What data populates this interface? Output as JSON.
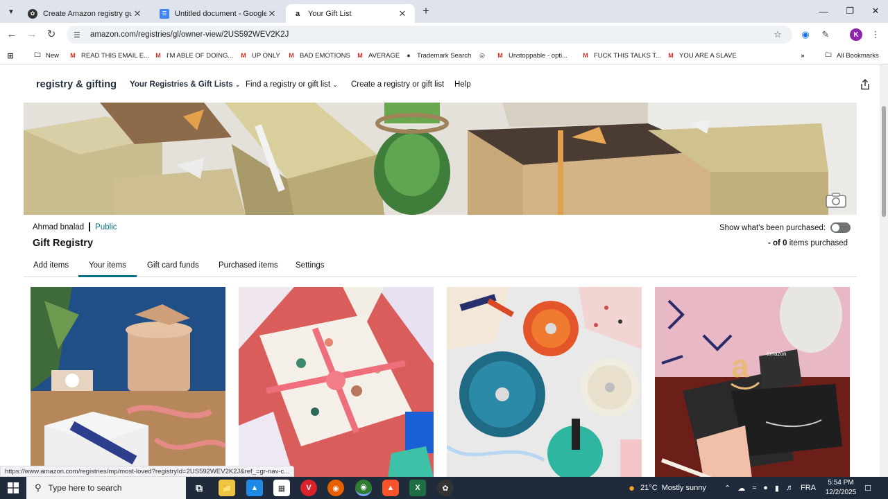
{
  "browser": {
    "tabs": [
      {
        "title": "Create Amazon registry guide",
        "active": false
      },
      {
        "title": "Untitled document - Google Do",
        "active": false
      },
      {
        "title": "Your Gift List",
        "active": true
      }
    ],
    "url": "amazon.com/registries/gl/owner-view/2US592WEV2K2J",
    "profile_initial": "K",
    "bookmarks": [
      {
        "label": "New",
        "icon": "folder-icon"
      },
      {
        "label": "READ THIS EMAIL E...",
        "icon": "gmail-icon"
      },
      {
        "label": "I'M ABLE OF DOING...",
        "icon": "gmail-icon"
      },
      {
        "label": "UP ONLY",
        "icon": "gmail-icon"
      },
      {
        "label": "BAD EMOTIONS",
        "icon": "gmail-icon"
      },
      {
        "label": "AVERAGE",
        "icon": "gmail-icon"
      },
      {
        "label": "Trademark Search",
        "icon": "pin-icon"
      },
      {
        "label": "",
        "icon": "globe-icon"
      },
      {
        "label": "Unstoppable - opti...",
        "icon": "gmail-icon"
      },
      {
        "label": "FUCK THIS TALKS T...",
        "icon": "gmail-icon"
      },
      {
        "label": "YOU ARE A SLAVE",
        "icon": "gmail-icon"
      }
    ],
    "all_bookmarks": "All Bookmarks"
  },
  "site": {
    "brand": "registry & gifting",
    "nav": {
      "your_registries": "Your Registries & Gift Lists",
      "find": "Find a registry or gift list",
      "create": "Create a registry or gift list",
      "help": "Help"
    }
  },
  "registry": {
    "owner": "Ahmad bnalad",
    "visibility": "Public",
    "title": "Gift Registry",
    "show_purchased": "Show what's been purchased:",
    "purchased_count_prefix": "- of",
    "purchased_count_value": "0",
    "purchased_count_suffix": "items purchased"
  },
  "page_tabs": [
    {
      "label": "Add items",
      "active": false
    },
    {
      "label": "Your items",
      "active": true
    },
    {
      "label": "Gift card funds",
      "active": false
    },
    {
      "label": "Purchased items",
      "active": false
    },
    {
      "label": "Settings",
      "active": false
    }
  ],
  "cards": [
    {
      "image": "gift-wrapping-scene"
    },
    {
      "image": "wrapped-present-ribbon"
    },
    {
      "image": "cookware-set"
    },
    {
      "image": "amazon-gift-card",
      "logo_text": "amazon"
    }
  ],
  "status_url": "https://www.amazon.com/registries/mp/most-loved?registryId=2US592WEV2K2J&ref_=gr-nav-c...",
  "taskbar": {
    "search_placeholder": "Type here to search",
    "weather_temp": "21°C",
    "weather_text": "Mostly sunny",
    "language": "FRA",
    "time": "5:54 PM",
    "date": "12/2/2025"
  },
  "colors": {
    "link": "#007185",
    "brand_dark": "#232f3e",
    "tab_strip": "#dfe3eb",
    "taskbar": "#1f2a3a"
  }
}
